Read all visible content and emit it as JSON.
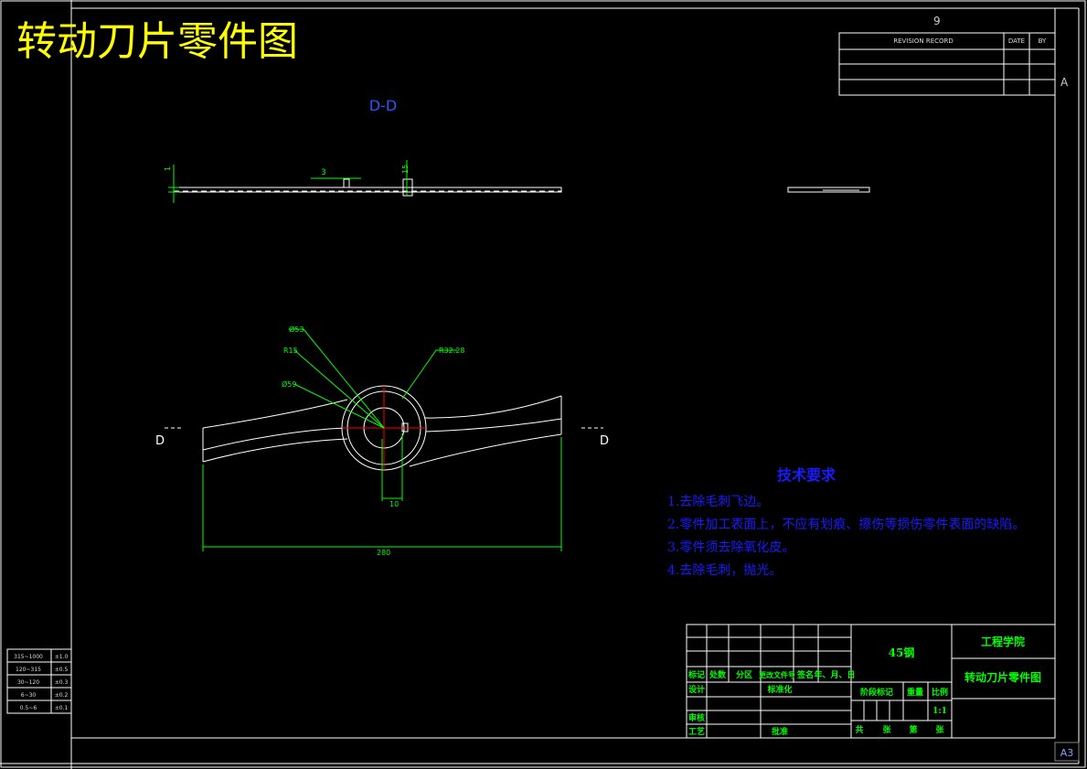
{
  "sheet": {
    "title": "转动刀片零件图",
    "top_number": "9",
    "zone_letter": "A",
    "paper_size": "A3"
  },
  "revision_table": {
    "col_revision": "REVISION RECORD",
    "col_date": "DATE",
    "col_by": "BY"
  },
  "section_view": {
    "label": "D-D",
    "dim_thickness": "1",
    "dim_slot": "3",
    "dim_hub": "15"
  },
  "plan_view": {
    "dim_dia53": "Ø53",
    "dim_r15": "R15",
    "dim_dia59": "Ø59",
    "dim_r328": "R32.28",
    "dim_10": "10",
    "dim_280": "280",
    "section_mark_left": "D",
    "section_mark_right": "D"
  },
  "tech_requirements": {
    "heading": "技术要求",
    "items": [
      "1.去除毛刺飞边。",
      "2.零件加工表面上，不应有划痕、擦伤等损伤零件表面的缺陷。",
      "3.零件须去除氧化皮。",
      "4.去除毛刺，抛光。"
    ]
  },
  "tolerance_table": {
    "rows": [
      {
        "range": "315~1000",
        "value": "±1.0"
      },
      {
        "range": "120~315",
        "value": "±0.5"
      },
      {
        "range": "30~120",
        "value": "±0.3"
      },
      {
        "range": "6~30",
        "value": "±0.2"
      },
      {
        "range": "0.5~6",
        "value": "±0.1"
      }
    ]
  },
  "title_block": {
    "material": "45钢",
    "school": "工程学院",
    "drawing_name": "转动刀片零件图",
    "header_cells": [
      "标记",
      "处数",
      "分区",
      "更改文件号",
      "签名",
      "年、月、日"
    ],
    "design": "设计",
    "standardize": "标准化",
    "stage_mark": "阶段标记",
    "weight": "重量",
    "scale_label": "比例",
    "scale_value": "1:1",
    "review": "审核",
    "process": "工艺",
    "approve": "批准",
    "total": "共",
    "sheets": "张",
    "page": "第",
    "sheet_unit": "张"
  },
  "colors": {
    "border": "#ffffff",
    "title": "#ffff00",
    "dimension": "#00ff00",
    "tech_text": "#1a1aff",
    "view_label": "#2a55ff",
    "centerline": "#ff0000",
    "titleblock_text": "#00ff00"
  }
}
